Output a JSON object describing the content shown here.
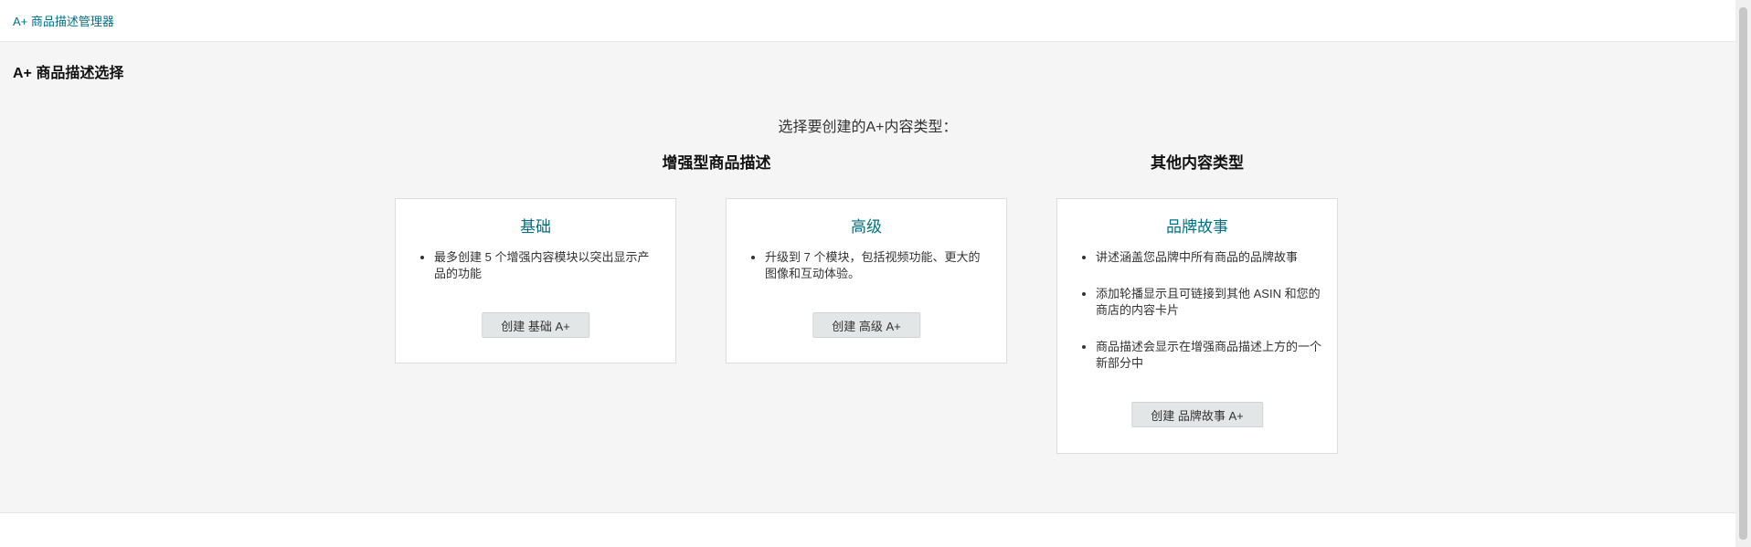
{
  "breadcrumb": {
    "label": "A+ 商品描述管理器"
  },
  "page": {
    "title": "A+ 商品描述选择",
    "prompt": "选择要创建的A+内容类型："
  },
  "sections": {
    "enhanced": "增强型商品描述",
    "other": "其他内容类型"
  },
  "cards": {
    "basic": {
      "title": "基础",
      "bullets": [
        "最多创建 5 个增强内容模块以突出显示产品的功能"
      ],
      "button": "创建 基础 A+"
    },
    "premium": {
      "title": "高级",
      "bullets": [
        "升级到 7 个模块，包括视频功能、更大的图像和互动体验。"
      ],
      "button": "创建 高级 A+"
    },
    "brand_story": {
      "title": "品牌故事",
      "bullets": [
        "讲述涵盖您品牌中所有商品的品牌故事",
        "添加轮播显示且可链接到其他 ASIN 和您的商店的内容卡片",
        "商品描述会显示在增强商品描述上方的一个新部分中"
      ],
      "button": "创建 品牌故事 A+"
    }
  },
  "colors": {
    "link": "#007185",
    "background": "#f5f5f5",
    "button_bg": "#e3e6e6"
  }
}
